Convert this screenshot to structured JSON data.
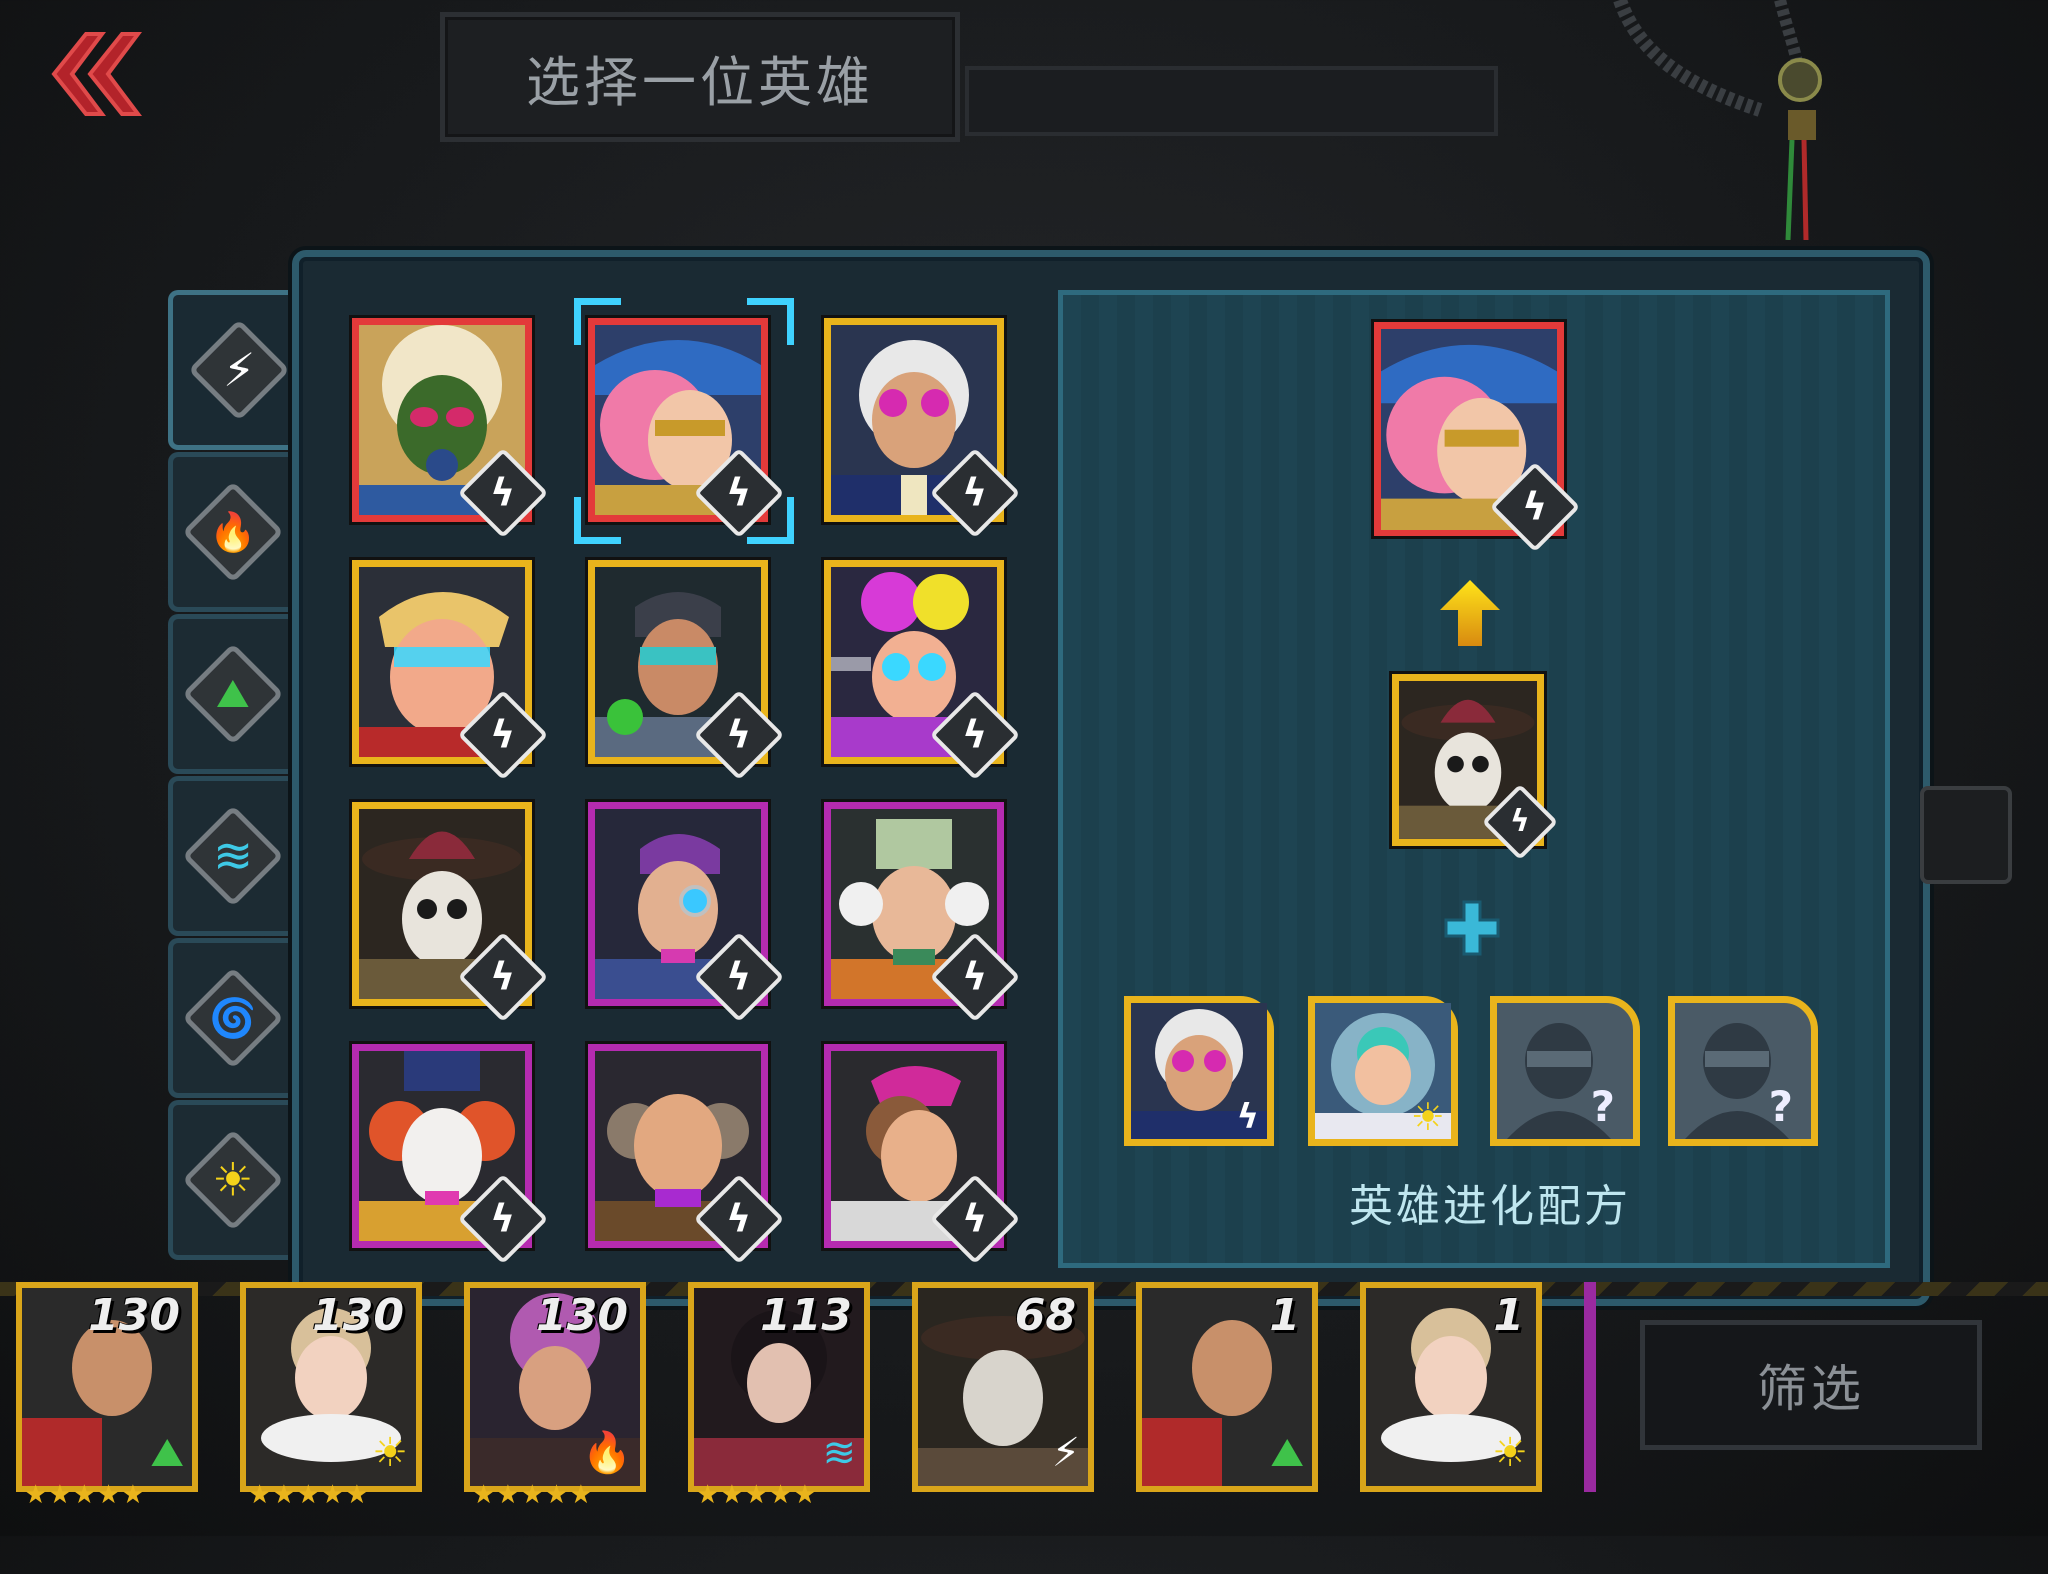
{
  "header": {
    "title": "选择一位英雄"
  },
  "side_tabs": [
    {
      "element": "lightning",
      "glyph": "⚡",
      "active": true
    },
    {
      "element": "fire",
      "glyph": "🔥",
      "active": false
    },
    {
      "element": "earth",
      "glyph": "⛰",
      "active": false
    },
    {
      "element": "water",
      "glyph": "≋",
      "active": false
    },
    {
      "element": "spirit",
      "glyph": "🌀",
      "active": false
    },
    {
      "element": "light",
      "glyph": "☀",
      "active": false
    }
  ],
  "hero_grid": [
    {
      "rarity": "red",
      "element": "lightning",
      "portrait": "gasmask-hero"
    },
    {
      "rarity": "red",
      "element": "lightning",
      "portrait": "pink-hair-captain",
      "selected": true
    },
    {
      "rarity": "gold",
      "element": "lightning",
      "portrait": "goggles-washington"
    },
    {
      "rarity": "gold",
      "element": "lightning",
      "portrait": "visor-president"
    },
    {
      "rarity": "gold",
      "element": "lightning",
      "portrait": "tech-goggles-man"
    },
    {
      "rarity": "gold",
      "element": "lightning",
      "portrait": "colorful-hair-gunner"
    },
    {
      "rarity": "gold",
      "element": "lightning",
      "portrait": "skull-sombrero"
    },
    {
      "rarity": "purple",
      "element": "lightning",
      "portrait": "monocle-inventor"
    },
    {
      "rarity": "purple",
      "element": "lightning",
      "portrait": "chef-scientist"
    },
    {
      "rarity": "purple",
      "element": "lightning",
      "portrait": "clown-tophat"
    },
    {
      "rarity": "purple",
      "element": "lightning",
      "portrait": "franklin"
    },
    {
      "rarity": "purple",
      "element": "lightning",
      "portrait": "pink-hat-lady"
    }
  ],
  "recipe": {
    "label": "英雄进化配方",
    "result": {
      "rarity": "red",
      "element": "lightning",
      "portrait": "pink-hair-captain"
    },
    "base": {
      "rarity": "gold",
      "element": "lightning",
      "portrait": "skull-sombrero"
    },
    "materials": [
      {
        "portrait": "goggles-washington",
        "element": "lightning",
        "locked": false
      },
      {
        "portrait": "astronaut-hero",
        "element": "light",
        "locked": false
      },
      {
        "portrait": "unknown-silhouette",
        "locked": true,
        "mark": "?"
      },
      {
        "portrait": "unknown-silhouette",
        "locked": true,
        "mark": "?"
      }
    ]
  },
  "roster": [
    {
      "level": "130",
      "element_glyph": "⛰",
      "stars": "★★★★★",
      "portrait": "red-cape-soldier"
    },
    {
      "level": "130",
      "element_glyph": "☀",
      "stars": "★★★★★",
      "portrait": "ruff-queen"
    },
    {
      "level": "130",
      "element_glyph": "🔥",
      "stars": "★★★★★",
      "portrait": "pink-hair-lady"
    },
    {
      "level": "113",
      "element_glyph": "≋",
      "stars": "★★★★★",
      "portrait": "dark-hair-woman"
    },
    {
      "level": "68",
      "element_glyph": "⚡",
      "stars": "",
      "portrait": "skull-sombrero"
    },
    {
      "level": "1",
      "element_glyph": "⛰",
      "stars": "",
      "portrait": "red-cape-soldier"
    },
    {
      "level": "1",
      "element_glyph": "☀",
      "stars": "",
      "portrait": "ruff-queen"
    }
  ],
  "filter_button": {
    "label": "筛选"
  },
  "colors": {
    "red": "#e33a3a",
    "gold": "#e9b41c",
    "purple": "#b52bb0",
    "selector": "#3fd2ff",
    "panel_border": "#2d5a6b"
  }
}
